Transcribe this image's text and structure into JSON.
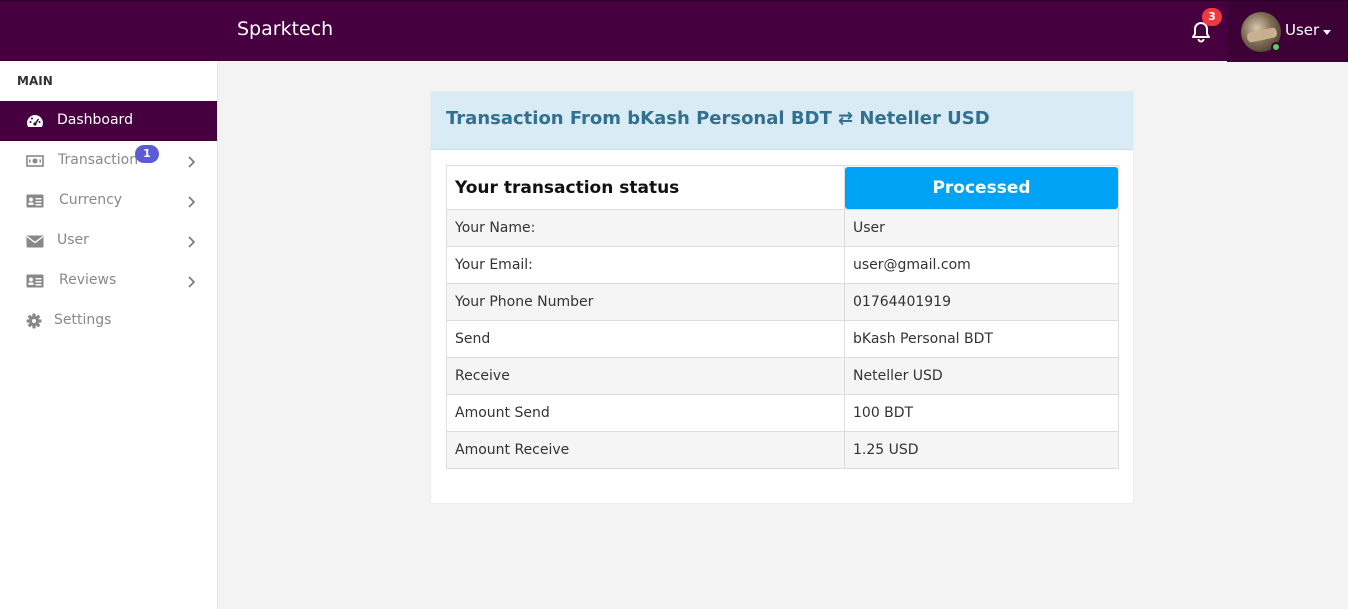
{
  "app": {
    "brand": "Sparktech",
    "notifications_count": "3",
    "user_name": "User",
    "colors": {
      "primary": "#460040",
      "accent": "#00a2f5",
      "badge": "#f0393f"
    }
  },
  "sidebar": {
    "section_title": "MAIN",
    "items": [
      {
        "label": "Dashboard",
        "icon": "dashboard-icon",
        "active": true
      },
      {
        "label": "Transaction",
        "icon": "money-icon",
        "badge": "1",
        "has_submenu": true
      },
      {
        "label": "Currency",
        "icon": "id-card-icon",
        "has_submenu": true
      },
      {
        "label": "User",
        "icon": "envelope-icon",
        "has_submenu": true
      },
      {
        "label": "Reviews",
        "icon": "id-card-icon",
        "has_submenu": true
      },
      {
        "label": "Settings",
        "icon": "gear-icon"
      }
    ]
  },
  "card": {
    "title": "Transaction From bKash Personal BDT ⇄ Neteller USD",
    "status_label": "Your transaction status",
    "status_value": "Processed",
    "rows": [
      {
        "label": "Your Name:",
        "value": "User"
      },
      {
        "label": "Your Email:",
        "value": "user@gmail.com"
      },
      {
        "label": "Your Phone Number",
        "value": "01764401919"
      },
      {
        "label": "Send",
        "value": "bKash Personal BDT"
      },
      {
        "label": "Receive",
        "value": "Neteller USD"
      },
      {
        "label": "Amount Send",
        "value": "100 BDT"
      },
      {
        "label": "Amount Receive",
        "value": "1.25 USD"
      }
    ]
  }
}
